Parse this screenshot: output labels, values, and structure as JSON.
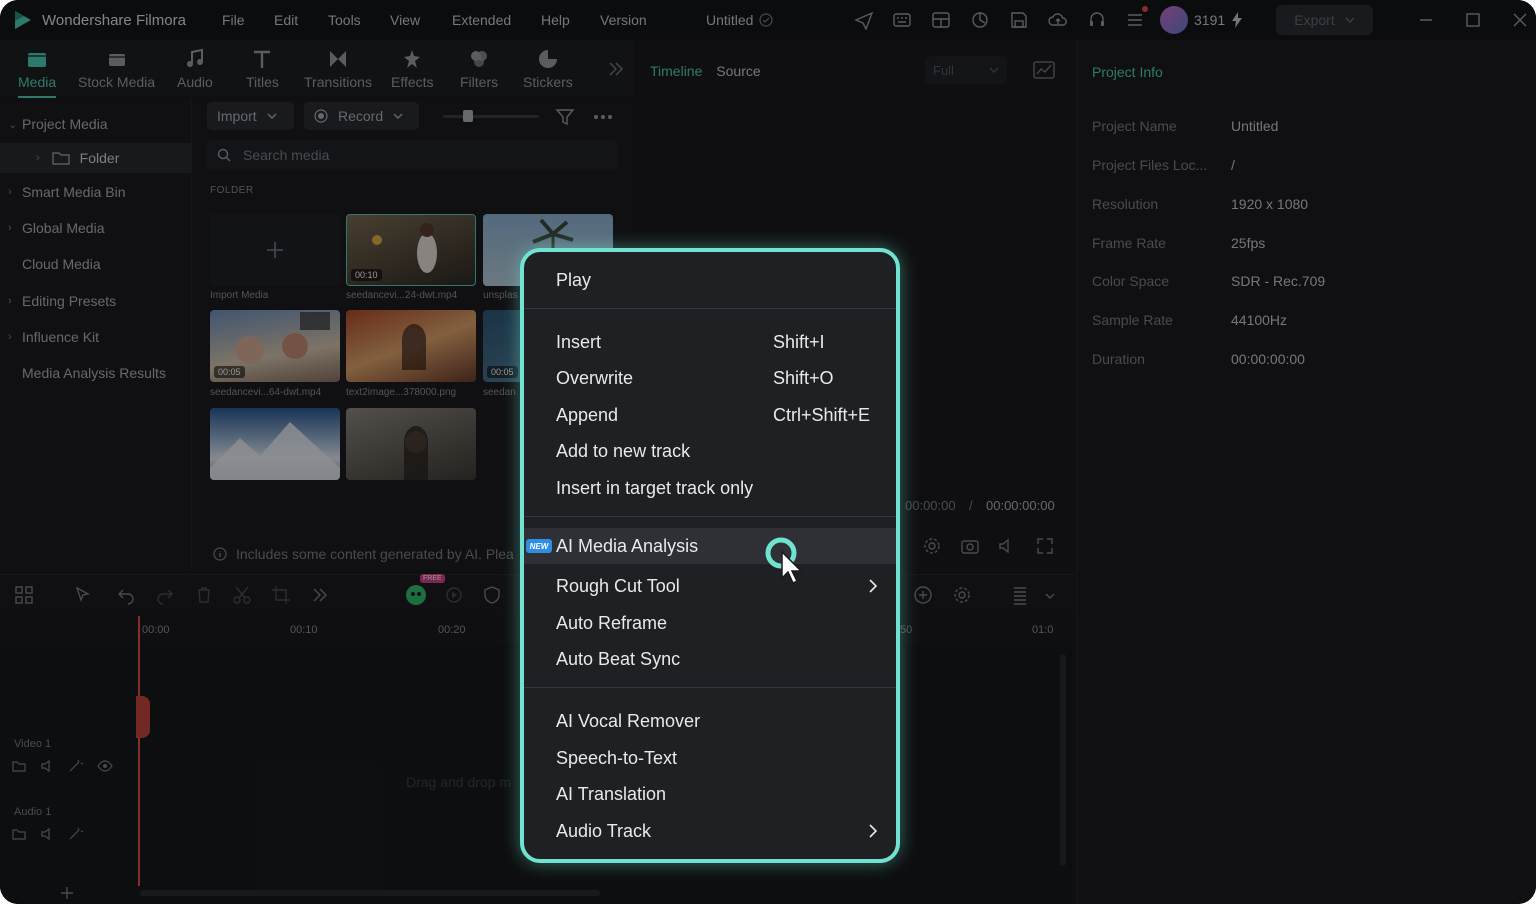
{
  "app": {
    "name": "Wondershare Filmora",
    "menus": [
      "File",
      "Edit",
      "Tools",
      "View",
      "Extended",
      "Help",
      "Version"
    ],
    "doc_title": "Untitled",
    "credits": "3191",
    "export_label": "Export"
  },
  "modules": [
    {
      "label": "Media",
      "icon": "media-icon",
      "active": true
    },
    {
      "label": "Stock Media",
      "icon": "stock-media-icon"
    },
    {
      "label": "Audio",
      "icon": "music-note-icon"
    },
    {
      "label": "Titles",
      "icon": "titles-icon"
    },
    {
      "label": "Transitions",
      "icon": "transitions-icon"
    },
    {
      "label": "Effects",
      "icon": "effects-icon"
    },
    {
      "label": "Filters",
      "icon": "filters-icon"
    },
    {
      "label": "Stickers",
      "icon": "stickers-icon"
    }
  ],
  "sidebar": {
    "items": [
      {
        "label": "Project Media",
        "expanded": true
      },
      {
        "label": "Folder",
        "selected": true
      },
      {
        "label": "Smart Media Bin"
      },
      {
        "label": "Global Media"
      },
      {
        "label": "Cloud Media"
      },
      {
        "label": "Editing Presets"
      },
      {
        "label": "Influence Kit"
      },
      {
        "label": "Media Analysis Results"
      }
    ]
  },
  "media": {
    "import_label": "Import",
    "record_label": "Record",
    "search_placeholder": "Search media",
    "folder_label": "FOLDER",
    "import_media_label": "Import Media",
    "thumbs": [
      {
        "name": "seedancevi...24-dwt.mp4",
        "duration": "00:10"
      },
      {
        "name": "unsplas"
      },
      {
        "name": "seedancevi...64-dwt.mp4",
        "duration": "00:05"
      },
      {
        "name": "text2image...378000.png"
      },
      {
        "name": "seedan",
        "duration": "00:05"
      }
    ],
    "ai_note": "Includes some content generated by AI. Plea"
  },
  "preview": {
    "tab_timeline": "Timeline",
    "tab_source": "Source",
    "quality": "Full",
    "time_current": "00:00:00",
    "time_total": "00:00:00:00"
  },
  "project_info": {
    "title": "Project Info",
    "rows": [
      {
        "key": "Project Name",
        "value": "Untitled"
      },
      {
        "key": "Project Files Loc...",
        "value": "/"
      },
      {
        "key": "Resolution",
        "value": "1920 x 1080"
      },
      {
        "key": "Frame Rate",
        "value": "25fps"
      },
      {
        "key": "Color Space",
        "value": "SDR - Rec.709"
      },
      {
        "key": "Sample Rate",
        "value": "44100Hz"
      },
      {
        "key": "Duration",
        "value": "00:00:00:00"
      }
    ]
  },
  "timeline": {
    "ticks": [
      "00:00",
      "00:10",
      "00:20",
      "50",
      "01:0"
    ],
    "free_badge": "FREE",
    "tracks": [
      {
        "name": "Video 1"
      },
      {
        "name": "Audio 1"
      }
    ],
    "drop_hint": "Drag and drop m"
  },
  "context_menu": {
    "items": [
      {
        "label": "Play"
      },
      {
        "label": "Insert",
        "shortcut": "Shift+I"
      },
      {
        "label": "Overwrite",
        "shortcut": "Shift+O"
      },
      {
        "label": "Append",
        "shortcut": "Ctrl+Shift+E"
      },
      {
        "label": "Add to new track"
      },
      {
        "label": "Insert in target track only"
      },
      {
        "label": "AI Media Analysis",
        "badge": "NEW",
        "highlighted": true
      },
      {
        "label": "Rough Cut Tool",
        "submenu": true
      },
      {
        "label": "Auto Reframe"
      },
      {
        "label": "Auto Beat Sync"
      },
      {
        "label": "AI Vocal Remover"
      },
      {
        "label": "Speech-to-Text"
      },
      {
        "label": "AI Translation"
      },
      {
        "label": "Audio Track",
        "submenu": true
      }
    ]
  },
  "colors": {
    "accent": "#4fd1b8",
    "menu_border": "#6fe3cf",
    "new_badge": "#2f8de4",
    "playhead": "#e0514e"
  }
}
